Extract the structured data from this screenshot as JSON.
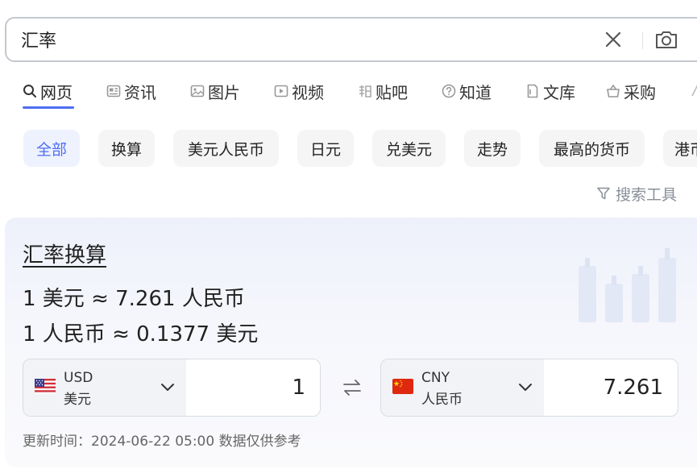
{
  "search": {
    "query": "汇率",
    "icons": {
      "clear": "close-icon",
      "camera": "camera-icon"
    }
  },
  "tabs": [
    {
      "label": "网页",
      "icon": "search-icon",
      "active": true
    },
    {
      "label": "资讯",
      "icon": "news-icon"
    },
    {
      "label": "图片",
      "icon": "image-icon"
    },
    {
      "label": "视频",
      "icon": "video-icon"
    },
    {
      "label": "贴吧",
      "icon": "tieba-icon"
    },
    {
      "label": "知道",
      "icon": "question-icon"
    },
    {
      "label": "文库",
      "icon": "doc-icon"
    },
    {
      "label": "采购",
      "icon": "basket-icon"
    }
  ],
  "chips": [
    {
      "label": "全部",
      "active": true
    },
    {
      "label": "换算"
    },
    {
      "label": "美元人民币"
    },
    {
      "label": "日元"
    },
    {
      "label": "兑美元"
    },
    {
      "label": "走势"
    },
    {
      "label": "最高的货币"
    },
    {
      "label": "港币"
    }
  ],
  "search_tools": {
    "label": "搜索工具",
    "icon": "filter-icon"
  },
  "card": {
    "title": "汇率换算",
    "rate_line_1": "1 美元 ≈ 7.261 人民币",
    "rate_line_2": "1 人民币 ≈ 0.1377 美元",
    "from": {
      "code": "USD",
      "name": "美元",
      "amount": "1",
      "flag": "us-flag-icon"
    },
    "to": {
      "code": "CNY",
      "name": "人民币",
      "amount": "7.261",
      "flag": "cn-flag-icon"
    },
    "swap_icon": "swap-arrows-icon",
    "update_text": "更新时间：2024-06-22 05:00 数据仅供参考"
  },
  "colors": {
    "accent": "#4e6ef2",
    "chip_bg": "#f5f5f6",
    "chip_active_bg": "#eef2ff",
    "muted": "#8a8f99"
  }
}
